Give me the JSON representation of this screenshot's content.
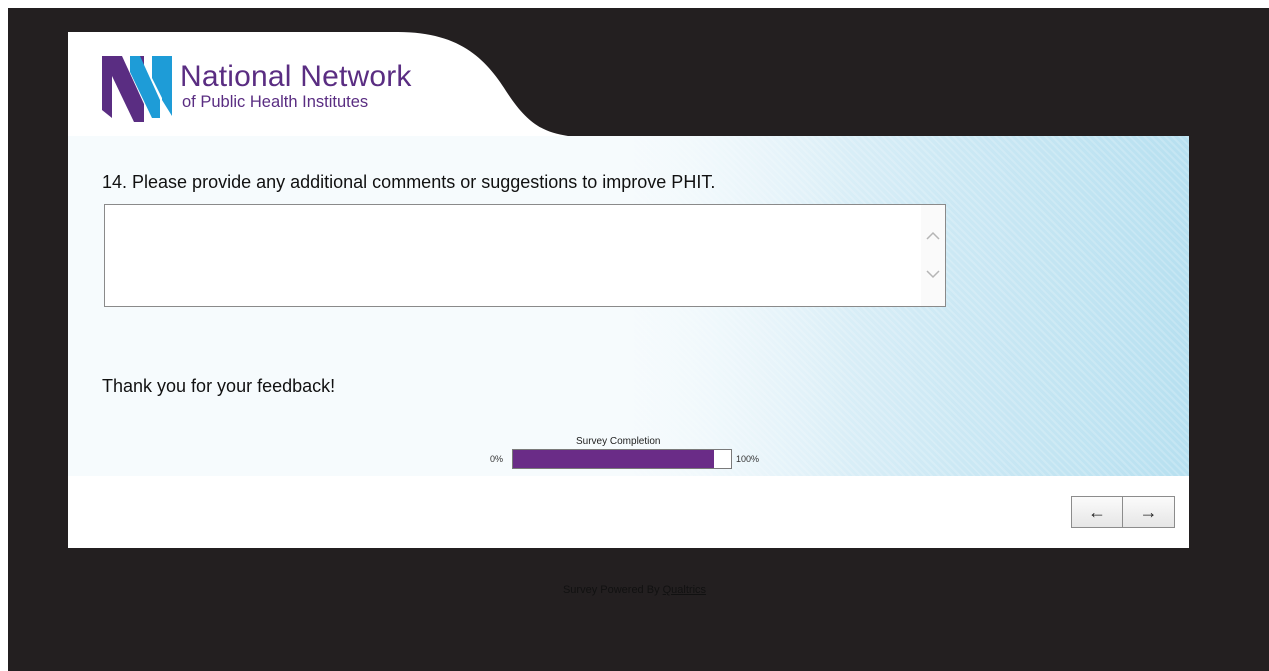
{
  "header": {
    "logo_line1": "National Network",
    "logo_line2": "of Public Health Institutes"
  },
  "question": {
    "text": "14. Please provide any additional comments or suggestions to improve PHIT.",
    "answer_value": ""
  },
  "closing": {
    "text": "Thank you for your feedback!"
  },
  "progress": {
    "title": "Survey Completion",
    "min_label": "0%",
    "max_label": "100%",
    "value_percent": 92
  },
  "navigation": {
    "back_label": "←",
    "next_label": "→"
  },
  "footer": {
    "powered_prefix": "Survey Powered By ",
    "powered_link": "Qualtrics"
  },
  "colors": {
    "brand_purple": "#5a2d82",
    "brand_blue": "#1e9cd7",
    "progress_fill": "#6a2c87"
  }
}
